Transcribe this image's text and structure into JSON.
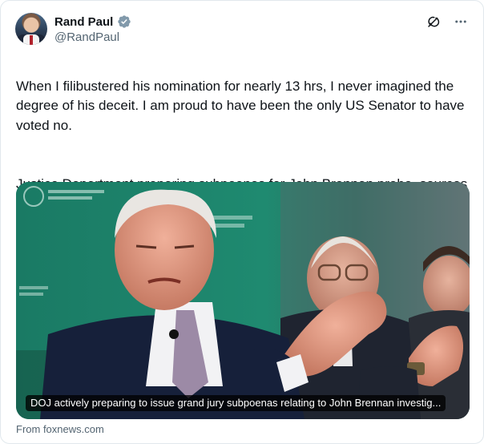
{
  "author": {
    "display_name": "Rand Paul",
    "handle": "@RandPaul",
    "verified": true,
    "verified_color": "#829aab"
  },
  "icons": {
    "grok": "grok-icon",
    "more": "more-icon",
    "verified": "verified-badge-icon"
  },
  "tweet": {
    "paragraph_1": "When I filibustered his nomination for nearly 13 hrs, I never imagined the degree of his deceit. I am proud to have been the only US Senator to have voted no.",
    "paragraph_2": "Justice Department preparing subpoenas for John Brennan probe, sources say | Fox"
  },
  "link_card": {
    "headline": "DOJ actively preparing to issue grand jury subpoenas relating to John Brennan investig...",
    "source": "From foxnews.com"
  },
  "colors": {
    "text": "#0f1419",
    "secondary": "#536471",
    "background_green": "#1e7b67"
  }
}
